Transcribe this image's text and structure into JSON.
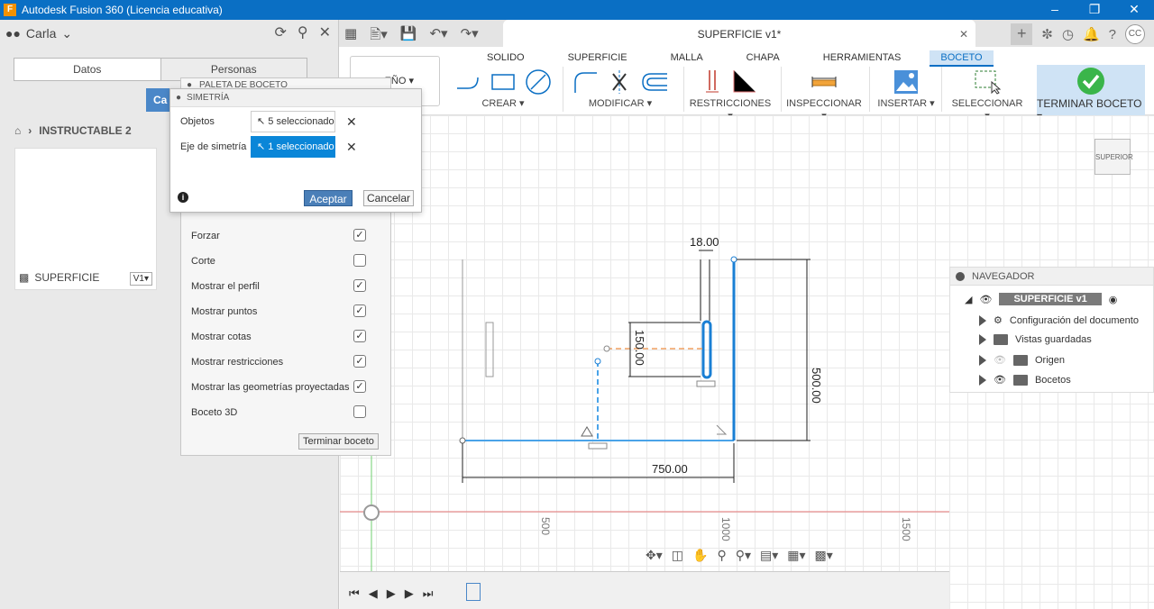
{
  "window": {
    "title": "Autodesk Fusion 360 (Licencia educativa)",
    "icon_letter": "F",
    "controls": [
      "–",
      "❐",
      "✕"
    ]
  },
  "leftpanel": {
    "user": "Carla",
    "tabs": [
      "Datos",
      "Personas"
    ],
    "new_button": "Ca",
    "breadcrumb": "INSTRUCTABLE 2",
    "item_name": "SUPERFICIE",
    "item_version": "V1▾"
  },
  "topbar": {
    "doc_title": "SUPERFICIE v1*",
    "avatar": "CC"
  },
  "ribbon": {
    "tabs": [
      "SOLIDO",
      "SUPERFICIE",
      "MALLA",
      "CHAPA",
      "HERRAMIENTAS",
      "BOCETO"
    ],
    "active_tab": "BOCETO",
    "workspace": "EÑO ▾",
    "groups": [
      "CREAR ▾",
      "MODIFICAR ▾",
      "RESTRICCIONES ▾",
      "INSPECCIONAR ▾",
      "INSERTAR ▾",
      "SELECCIONAR ▾",
      "TERMINAR BOCETO ▾"
    ]
  },
  "palette": {
    "title": "PALETA DE BOCETO",
    "options": [
      {
        "label": "Forzar",
        "checked": true
      },
      {
        "label": "Corte",
        "checked": false
      },
      {
        "label": "Mostrar el perfil",
        "checked": true
      },
      {
        "label": "Mostrar puntos",
        "checked": true
      },
      {
        "label": "Mostrar cotas",
        "checked": true
      },
      {
        "label": "Mostrar restricciones",
        "checked": true
      },
      {
        "label": "Mostrar las geometrías proyectadas",
        "checked": true
      },
      {
        "label": "Boceto 3D",
        "checked": false
      }
    ],
    "end_button": "Terminar boceto"
  },
  "symmetry": {
    "title": "SIMETRÍA",
    "rows": [
      {
        "label": "Objetos",
        "value": "5 seleccionado"
      },
      {
        "label": "Eje de simetría",
        "value": "1 seleccionado"
      }
    ],
    "accept": "Aceptar",
    "cancel": "Cancelar"
  },
  "canvas": {
    "dims": [
      "18.00",
      "150.00",
      "500.00",
      "750.00"
    ],
    "ruler": [
      "500",
      "1000",
      "1500"
    ],
    "viewcube": "SUPERIOR"
  },
  "navigator": {
    "title": "NAVEGADOR",
    "root": "SUPERFICIE v1",
    "children": [
      "Configuración del documento",
      "Vistas guardadas",
      "Origen",
      "Bocetos"
    ]
  },
  "colors": {
    "accent": "#0a6fc4",
    "sketch_blue": "#1a7fd4",
    "dialog_active": "#0a86d8"
  }
}
